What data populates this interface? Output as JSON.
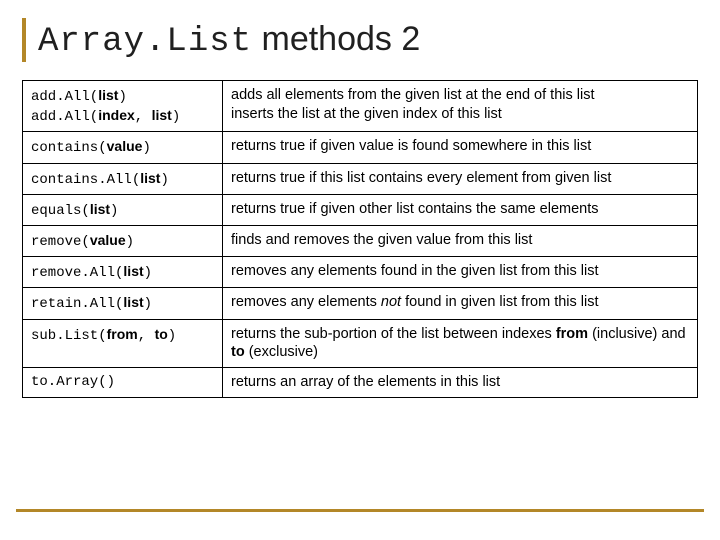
{
  "title": {
    "code": "Array.List",
    "rest": " methods 2"
  },
  "rows": [
    {
      "sig_html": "add.All(<span class='p'>list</span>)<br>add.All(<span class='p'>index</span>, <span class='p'>list</span>)",
      "desc_html": "adds all elements from the given list at the end of this list<br>inserts the list at the given index of this list"
    },
    {
      "sig_html": "contains(<span class='p'>value</span>)",
      "desc_html": "returns true if given value is found somewhere in this list"
    },
    {
      "sig_html": "contains.All(<span class='p'>list</span>)",
      "desc_html": "returns true if this list contains every element from given list"
    },
    {
      "sig_html": "equals(<span class='p'>list</span>)",
      "desc_html": "returns true if given other list contains the same elements"
    },
    {
      "sig_html": "remove(<span class='p'>value</span>)",
      "desc_html": "finds and removes the given value from this list"
    },
    {
      "sig_html": "remove.All(<span class='p'>list</span>)",
      "desc_html": "removes any elements found in the given list from this list"
    },
    {
      "sig_html": "retain.All(<span class='p'>list</span>)",
      "desc_html": "removes any elements <span class='i'>not</span> found in given list from this list"
    },
    {
      "sig_html": "sub.List(<span class='p'>from</span>, <span class='p'>to</span>)",
      "desc_html": "returns the sub-portion of the list between indexes <span class='b'>from</span> (inclusive) and <span class='b'>to</span> (exclusive)"
    },
    {
      "sig_html": "to.Array()",
      "desc_html": "returns an array of the elements in this list"
    }
  ]
}
